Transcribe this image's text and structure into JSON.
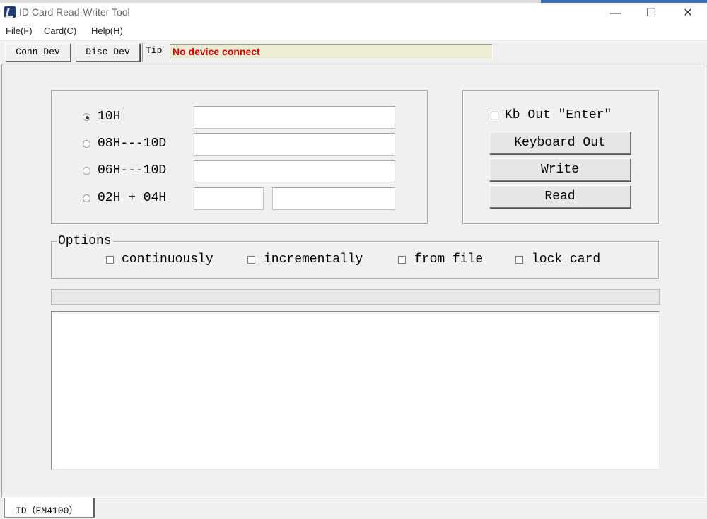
{
  "window": {
    "title": "ID Card Read-Writer Tool",
    "controls": {
      "minimize": "—",
      "maximize": "☐",
      "close": "✕"
    }
  },
  "menu": [
    {
      "label": "File(F)"
    },
    {
      "label": "Card(C)"
    },
    {
      "label": "Help(H)"
    }
  ],
  "toolbar": {
    "connect_label": "Conn Dev",
    "disconnect_label": "Disc Dev",
    "tip_label": "Tip",
    "tip_text": "No device connect",
    "tip_color": "#d40000"
  },
  "format": {
    "options": [
      {
        "label": "10H",
        "selected": true,
        "value": ""
      },
      {
        "label": "08H---10D",
        "selected": false,
        "value": ""
      },
      {
        "label": "06H---10D",
        "selected": false,
        "value": ""
      },
      {
        "label": "02H + 04H",
        "selected": false,
        "value": "",
        "value2": ""
      }
    ]
  },
  "actions": {
    "kb_enter_label": "Kb Out \"Enter\"",
    "kb_enter_checked": false,
    "keyboard_out_label": "Keyboard Out",
    "write_label": "Write",
    "read_label": "Read"
  },
  "options": {
    "title": "Options",
    "items": [
      {
        "label": "continuously",
        "checked": false
      },
      {
        "label": "incrementally",
        "checked": false
      },
      {
        "label": "from file",
        "checked": false
      },
      {
        "label": "lock card",
        "checked": false
      }
    ]
  },
  "progress": {
    "value": 0
  },
  "output": {
    "text": ""
  },
  "tabs": [
    {
      "label": "ID（EM4100）",
      "active": true
    }
  ]
}
